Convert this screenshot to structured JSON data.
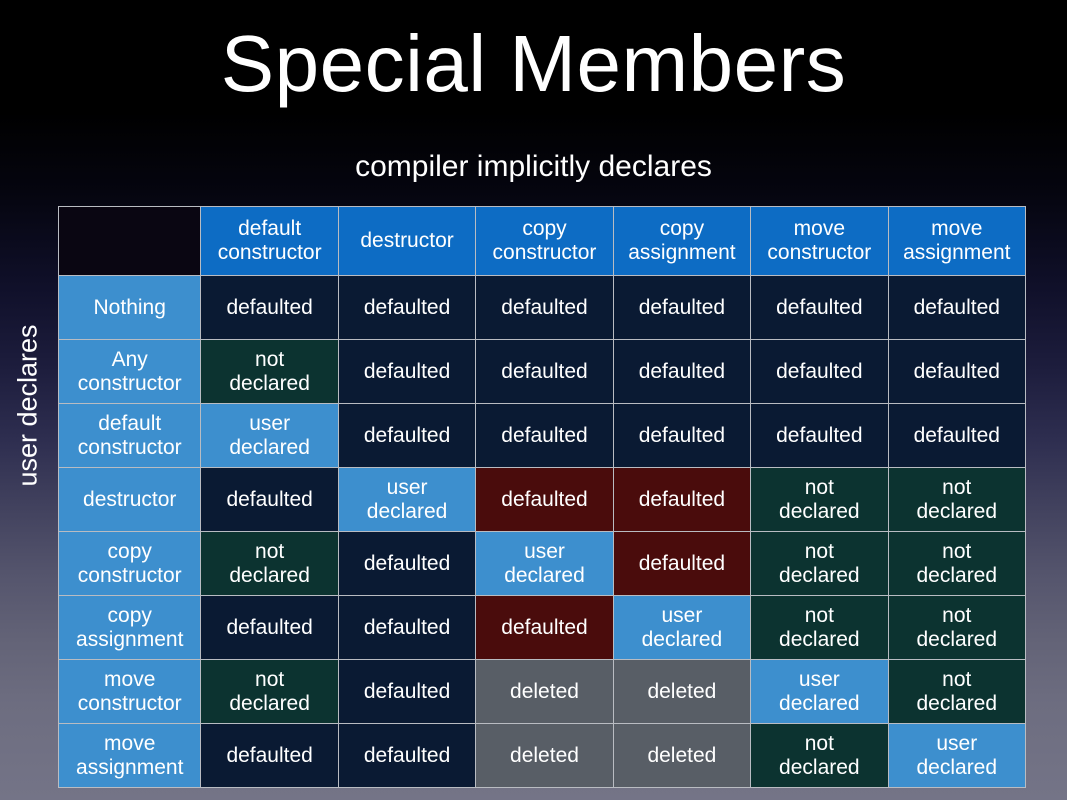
{
  "slide": {
    "title": "Special Members",
    "subtitle": "compiler implicitly declares",
    "vertical_axis_label": "user declares"
  },
  "colors": {
    "header_blue": "#0d6cc4",
    "row_label_blue": "#3d8fce",
    "defaulted_navy": "#0a1a33",
    "not_declared_green": "#0c3330",
    "user_declared_blue": "#3d8fce",
    "defaulted_red": "#4a0c0c",
    "deleted_gray": "#585e66",
    "corner_black": "#0a0612",
    "grid_line": "#b9bcc2",
    "text": "#ffffff"
  },
  "chart_data": {
    "type": "table",
    "title": "Special Members",
    "subtitle": "compiler implicitly declares",
    "xlabel": "compiler implicitly declares",
    "ylabel": "user declares",
    "corner_label": "",
    "columns": [
      "default constructor",
      "destructor",
      "copy constructor",
      "copy assignment",
      "move constructor",
      "move assignment"
    ],
    "rows": [
      "Nothing",
      "Any constructor",
      "default constructor",
      "destructor",
      "copy constructor",
      "copy assignment",
      "move constructor",
      "move assignment"
    ],
    "cells": [
      [
        {
          "text": "defaulted",
          "state": "defaulted"
        },
        {
          "text": "defaulted",
          "state": "defaulted"
        },
        {
          "text": "defaulted",
          "state": "defaulted"
        },
        {
          "text": "defaulted",
          "state": "defaulted"
        },
        {
          "text": "defaulted",
          "state": "defaulted"
        },
        {
          "text": "defaulted",
          "state": "defaulted"
        }
      ],
      [
        {
          "text": "not declared",
          "state": "not-declared"
        },
        {
          "text": "defaulted",
          "state": "defaulted"
        },
        {
          "text": "defaulted",
          "state": "defaulted"
        },
        {
          "text": "defaulted",
          "state": "defaulted"
        },
        {
          "text": "defaulted",
          "state": "defaulted"
        },
        {
          "text": "defaulted",
          "state": "defaulted"
        }
      ],
      [
        {
          "text": "user declared",
          "state": "user-declared"
        },
        {
          "text": "defaulted",
          "state": "defaulted"
        },
        {
          "text": "defaulted",
          "state": "defaulted"
        },
        {
          "text": "defaulted",
          "state": "defaulted"
        },
        {
          "text": "defaulted",
          "state": "defaulted"
        },
        {
          "text": "defaulted",
          "state": "defaulted"
        }
      ],
      [
        {
          "text": "defaulted",
          "state": "defaulted"
        },
        {
          "text": "user declared",
          "state": "user-declared"
        },
        {
          "text": "defaulted",
          "state": "defaulted-deprecated"
        },
        {
          "text": "defaulted",
          "state": "defaulted-deprecated"
        },
        {
          "text": "not declared",
          "state": "not-declared"
        },
        {
          "text": "not declared",
          "state": "not-declared"
        }
      ],
      [
        {
          "text": "not declared",
          "state": "not-declared"
        },
        {
          "text": "defaulted",
          "state": "defaulted"
        },
        {
          "text": "user declared",
          "state": "user-declared"
        },
        {
          "text": "defaulted",
          "state": "defaulted-deprecated"
        },
        {
          "text": "not declared",
          "state": "not-declared"
        },
        {
          "text": "not declared",
          "state": "not-declared"
        }
      ],
      [
        {
          "text": "defaulted",
          "state": "defaulted"
        },
        {
          "text": "defaulted",
          "state": "defaulted"
        },
        {
          "text": "defaulted",
          "state": "defaulted-deprecated"
        },
        {
          "text": "user declared",
          "state": "user-declared"
        },
        {
          "text": "not declared",
          "state": "not-declared"
        },
        {
          "text": "not declared",
          "state": "not-declared"
        }
      ],
      [
        {
          "text": "not declared",
          "state": "not-declared"
        },
        {
          "text": "defaulted",
          "state": "defaulted"
        },
        {
          "text": "deleted",
          "state": "deleted"
        },
        {
          "text": "deleted",
          "state": "deleted"
        },
        {
          "text": "user declared",
          "state": "user-declared"
        },
        {
          "text": "not declared",
          "state": "not-declared"
        }
      ],
      [
        {
          "text": "defaulted",
          "state": "defaulted"
        },
        {
          "text": "defaulted",
          "state": "defaulted"
        },
        {
          "text": "deleted",
          "state": "deleted"
        },
        {
          "text": "deleted",
          "state": "deleted"
        },
        {
          "text": "not declared",
          "state": "not-declared"
        },
        {
          "text": "user declared",
          "state": "user-declared"
        }
      ]
    ]
  }
}
